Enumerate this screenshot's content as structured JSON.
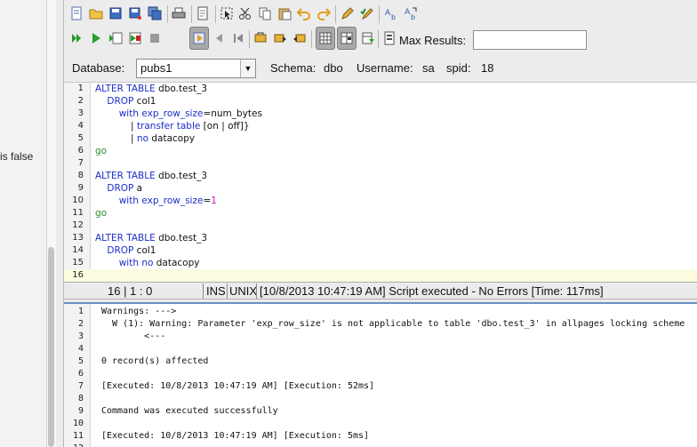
{
  "left_panel": {
    "snippet": "is false"
  },
  "toolbar1": {
    "icons": [
      "new-file-icon",
      "open-folder-icon",
      "save-icon",
      "save-as-icon",
      "save-all-icon",
      "print-icon",
      "print-preview-icon",
      "select-icon",
      "cut-icon",
      "copy-icon",
      "paste-icon",
      "undo-icon",
      "redo-icon",
      "edit-icon",
      "edit-check-icon",
      "find-icon",
      "find-replace-icon"
    ]
  },
  "toolbar2": {
    "icons": [
      "execute-icon",
      "run-icon",
      "run-current-icon",
      "stop-batch-icon",
      "stop-icon",
      "tool-pressed-icon",
      "prev-icon",
      "back-icon",
      "bookmark-icon",
      "bookmark-next-icon",
      "bookmark-prev-icon",
      "grid-results-icon",
      "text-results-icon",
      "export-results-icon",
      "history-icon"
    ],
    "max_results_label": "Max Results:",
    "max_results_value": ""
  },
  "dbrow": {
    "database_label": "Database:",
    "database_value": "pubs1",
    "schema_label": "Schema:",
    "schema_value": "dbo",
    "username_label": "Username:",
    "username_value": "sa",
    "spid_label": "spid:",
    "spid_value": "18"
  },
  "editor": {
    "lines": [
      {
        "n": "1",
        "segs": [
          [
            "kw",
            "ALTER TABLE"
          ],
          [
            "t",
            " dbo.test_3"
          ]
        ]
      },
      {
        "n": "2",
        "segs": [
          [
            "t",
            "    "
          ],
          [
            "kw",
            "DROP"
          ],
          [
            "t",
            " col1"
          ]
        ]
      },
      {
        "n": "3",
        "segs": [
          [
            "t",
            "        "
          ],
          [
            "kw",
            "with"
          ],
          [
            "t",
            " "
          ],
          [
            "kw",
            "exp_row_size"
          ],
          [
            "t",
            "=num_bytes"
          ]
        ]
      },
      {
        "n": "4",
        "segs": [
          [
            "t",
            "            | "
          ],
          [
            "kw",
            "transfer table"
          ],
          [
            "t",
            " [on | off]}"
          ]
        ]
      },
      {
        "n": "5",
        "segs": [
          [
            "t",
            "            | "
          ],
          [
            "kw",
            "no"
          ],
          [
            "t",
            " datacopy"
          ]
        ]
      },
      {
        "n": "6",
        "segs": [
          [
            "go",
            "go"
          ]
        ]
      },
      {
        "n": "7",
        "segs": []
      },
      {
        "n": "8",
        "segs": [
          [
            "kw",
            "ALTER TABLE"
          ],
          [
            "t",
            " dbo.test_3"
          ]
        ]
      },
      {
        "n": "9",
        "segs": [
          [
            "t",
            "    "
          ],
          [
            "kw",
            "DROP"
          ],
          [
            "t",
            " a"
          ]
        ]
      },
      {
        "n": "10",
        "segs": [
          [
            "t",
            "        "
          ],
          [
            "kw",
            "with"
          ],
          [
            "t",
            " "
          ],
          [
            "kw",
            "exp_row_size"
          ],
          [
            "t",
            "="
          ],
          [
            "num",
            "1"
          ]
        ]
      },
      {
        "n": "11",
        "segs": [
          [
            "go",
            "go"
          ]
        ]
      },
      {
        "n": "12",
        "segs": []
      },
      {
        "n": "13",
        "segs": [
          [
            "kw",
            "ALTER TABLE"
          ],
          [
            "t",
            " dbo.test_3"
          ]
        ]
      },
      {
        "n": "14",
        "segs": [
          [
            "t",
            "    "
          ],
          [
            "kw",
            "DROP"
          ],
          [
            "t",
            " col1"
          ]
        ]
      },
      {
        "n": "15",
        "segs": [
          [
            "t",
            "        "
          ],
          [
            "kw",
            "with"
          ],
          [
            "t",
            " "
          ],
          [
            "kw",
            "no"
          ],
          [
            "t",
            " datacopy"
          ]
        ]
      },
      {
        "n": "16",
        "segs": []
      }
    ]
  },
  "status": {
    "position": "16 | 1 : 0",
    "mode": "INS",
    "line_endings": "UNIX",
    "message": "[10/8/2013 10:47:19 AM] Script executed - No Errors [Time: 117ms]"
  },
  "output": {
    "lines": [
      {
        "n": "1",
        "text": "Warnings: --->"
      },
      {
        "n": "2",
        "text": "  W (1): Warning: Parameter 'exp_row_size' is not applicable to table 'dbo.test_3' in allpages locking scheme"
      },
      {
        "n": "3",
        "text": "        <---"
      },
      {
        "n": "4",
        "text": ""
      },
      {
        "n": "5",
        "text": "0 record(s) affected"
      },
      {
        "n": "6",
        "text": ""
      },
      {
        "n": "7",
        "text": "[Executed: 10/8/2013 10:47:19 AM] [Execution: 52ms]"
      },
      {
        "n": "8",
        "text": ""
      },
      {
        "n": "9",
        "text": "Command was executed successfully"
      },
      {
        "n": "10",
        "text": ""
      },
      {
        "n": "11",
        "text": "[Executed: 10/8/2013 10:47:19 AM] [Execution: 5ms]"
      },
      {
        "n": "12",
        "text": ""
      }
    ]
  }
}
